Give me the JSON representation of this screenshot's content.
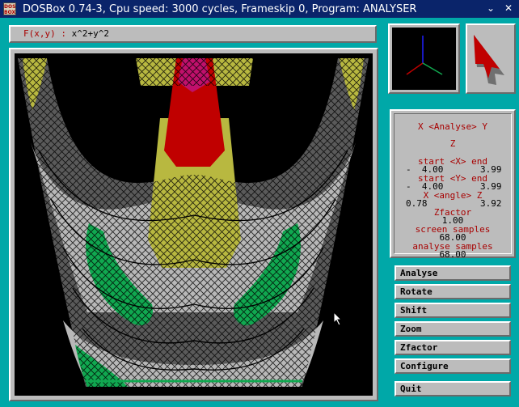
{
  "window": {
    "title": "DOSBox 0.74-3, Cpu speed:    3000 cycles, Frameskip  0, Program: ANALYSER",
    "icon_text": "DOS BOX",
    "controls": [
      "chevron-down-icon",
      "close-icon"
    ]
  },
  "formula": {
    "label": "F(x,y)  :",
    "expression": "x^2+y^2"
  },
  "panel": {
    "heading": "X <Analyse> Y",
    "axis_z": "Z",
    "start_x_label": "start <X> end",
    "start_x_from": "-  4.00",
    "start_x_to": "3.99",
    "start_y_label": "start <Y> end",
    "start_y_from": "-  4.00",
    "start_y_to": "3.99",
    "angle_label": "X <angle> Z",
    "angle_x": "0.78",
    "angle_z": "3.92",
    "zfactor_label": "Zfactor",
    "zfactor_value": "1.00",
    "screen_samples_label": "screen samples",
    "screen_samples_value": "68.00",
    "analyse_samples_label": "analyse samples",
    "analyse_samples_value": "68.00"
  },
  "menu": {
    "analyse": "Analyse",
    "rotate": "Rotate",
    "shift": "Shift",
    "zoom": "Zoom",
    "zfactor": "Zfactor",
    "configure": "Configure",
    "quit": "Quit"
  },
  "colors": {
    "desktop": "#00a8a8",
    "panel": "#bcbcbc",
    "title_bar": "#0a246a",
    "label_red": "#a80000",
    "surface_gray": "#5a5a5a",
    "surface_light": "#b8b8b8",
    "surface_yellow": "#b8b840",
    "surface_red": "#c00000",
    "surface_magenta": "#c0106c",
    "surface_green": "#10a850"
  }
}
